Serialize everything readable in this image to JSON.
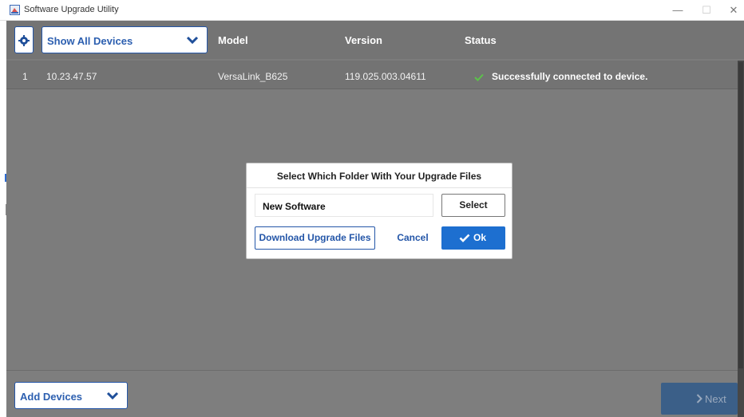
{
  "window": {
    "title": "Software Upgrade Utility",
    "controls": {
      "minimize": "—",
      "maximize": "☐",
      "close": "✕"
    }
  },
  "toolbar": {
    "settings_icon": "gear-icon",
    "device_filter": "Show All Devices"
  },
  "table": {
    "columns": [
      "Model",
      "Version",
      "Status"
    ],
    "rows": [
      {
        "index": "1",
        "ip": "10.23.47.57",
        "model": "VersaLink_B625",
        "version": "119.025.003.04611",
        "status": "Successfully connected to device.",
        "status_icon": "check-icon"
      }
    ]
  },
  "dialog": {
    "title": "Select Which Folder With Your Upgrade Files",
    "folder_value": "New Software",
    "select_label": "Select",
    "download_label": "Download Upgrade Files",
    "cancel_label": "Cancel",
    "ok_label": "Ok"
  },
  "footer": {
    "add_devices_label": "Add Devices",
    "next_label": "Next"
  },
  "colors": {
    "accent": "#1d6fd0",
    "overlay": "#7c7c7c",
    "success": "#5cc24a"
  }
}
